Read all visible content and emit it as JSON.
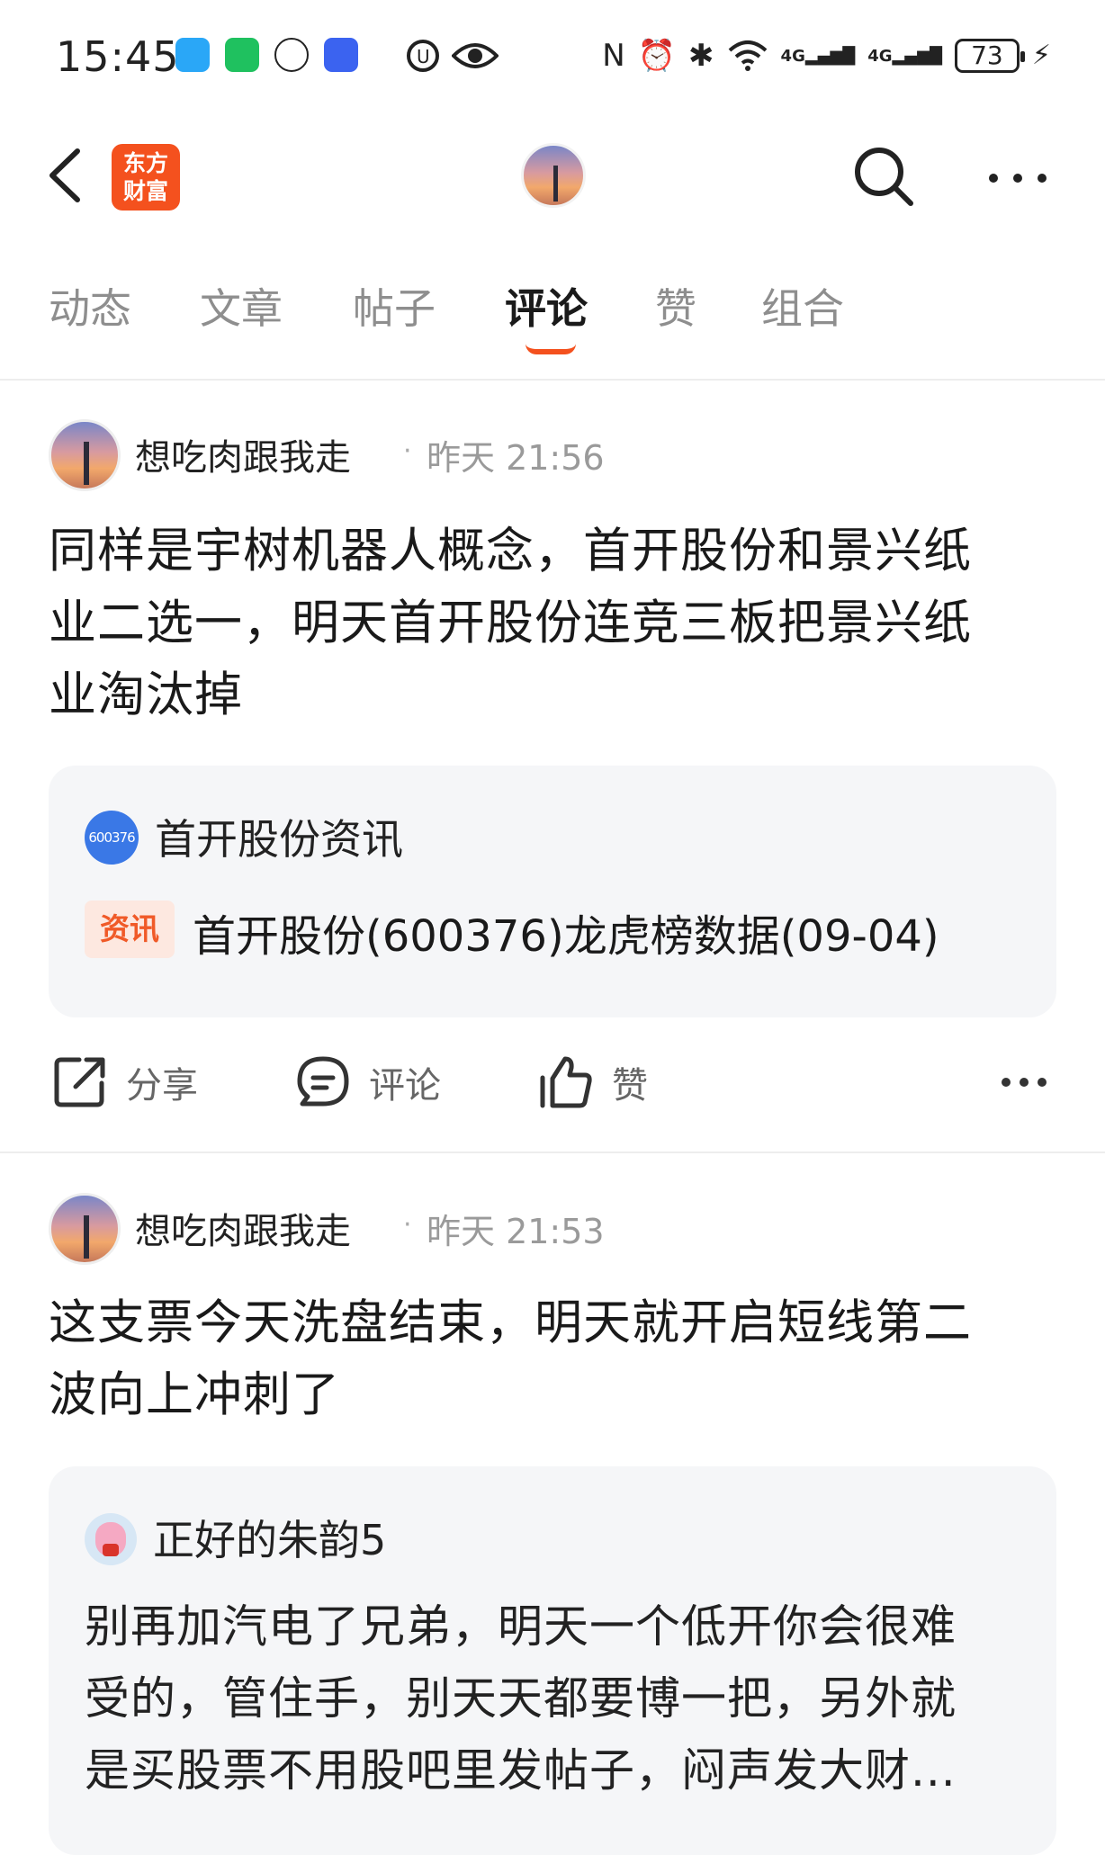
{
  "status_bar": {
    "time": "15:45",
    "network_1": "4G",
    "network_2": "4G",
    "battery": "73"
  },
  "nav": {
    "brand_line1": "东方",
    "brand_line2": "财富"
  },
  "tabs": [
    {
      "label": "动态"
    },
    {
      "label": "文章"
    },
    {
      "label": "帖子"
    },
    {
      "label": "评论"
    },
    {
      "label": "赞"
    },
    {
      "label": "组合"
    }
  ],
  "posts": [
    {
      "user": "想吃肉跟我走",
      "separator": "·",
      "time": "昨天 21:56",
      "body_lines": [
        "同样是宇树机器人概念，首开股份和景兴纸",
        "业二选一，明天首开股份连竞三板把景兴纸",
        "业淘汰掉"
      ],
      "card": {
        "source_icon": "600376",
        "source_name": "首开股份资讯",
        "tag": "资讯",
        "title": "首开股份(600376)龙虎榜数据(09-04)"
      },
      "actions": {
        "share": "分享",
        "comment": "评论",
        "like": "赞"
      }
    },
    {
      "user": "想吃肉跟我走",
      "separator": "·",
      "time": "昨天 21:53",
      "body_lines": [
        "这支票今天洗盘结束，明天就开启短线第二",
        "波向上冲刺了"
      ],
      "reply": {
        "user": "正好的朱韵5",
        "body_lines": [
          "别再加汽电了兄弟，明天一个低开你会很难",
          "受的，管住手，别天天都要博一把，另外就",
          "是买股票不用股吧里发帖子，闷声发大财..."
        ]
      }
    }
  ]
}
